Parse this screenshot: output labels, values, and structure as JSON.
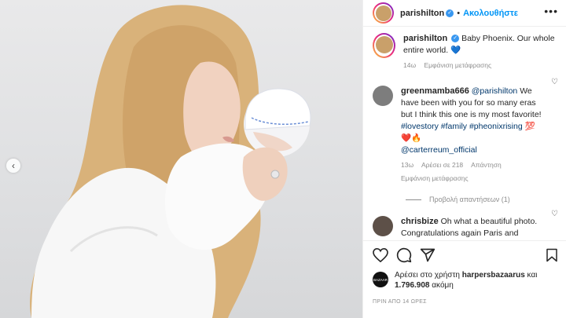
{
  "post": {
    "username": "parishilton",
    "follow_label": "Ακολουθήστε",
    "more_icon": "more-options-icon"
  },
  "caption": {
    "username": "parishilton",
    "text": "Baby Phoenix. Our whole entire world. 💙",
    "time": "14ω",
    "translate": "Εμφάνιση μετάφρασης"
  },
  "comments": [
    {
      "username": "greenmamba666",
      "mention": "@parishilton",
      "text": " We have been with you for so many eras but I think this one is my most favorite! ",
      "hashtags": "#lovestory #family #pheonixrising",
      "emoji": " 💯❤️🔥",
      "mention2": "@carterreum_official",
      "time": "13ω",
      "likes": "Αρέσει σε 218",
      "reply": "Απάντηση",
      "translate": "Εμφάνιση μετάφρασης",
      "view_replies": "Προβολή απαντήσεων (1)"
    },
    {
      "username": "chrisbize",
      "text": "Oh what a beautiful photo. Congratulations again Paris and Carter. I love the name. Welcome to"
    }
  ],
  "likes": {
    "prefix": "Αρέσει στο χρήστη ",
    "user": "harpersbazaarus",
    "middle": " και",
    "count": "1.796.908",
    "suffix": " ακόμη",
    "badge": "BAZAAR"
  },
  "posted_ago": "ΠΡΙΝ ΑΠΟ 14 ΩΡΕΣ",
  "colors": {
    "link": "#00376b",
    "follow": "#0095f6",
    "verified": "#3897f0"
  }
}
